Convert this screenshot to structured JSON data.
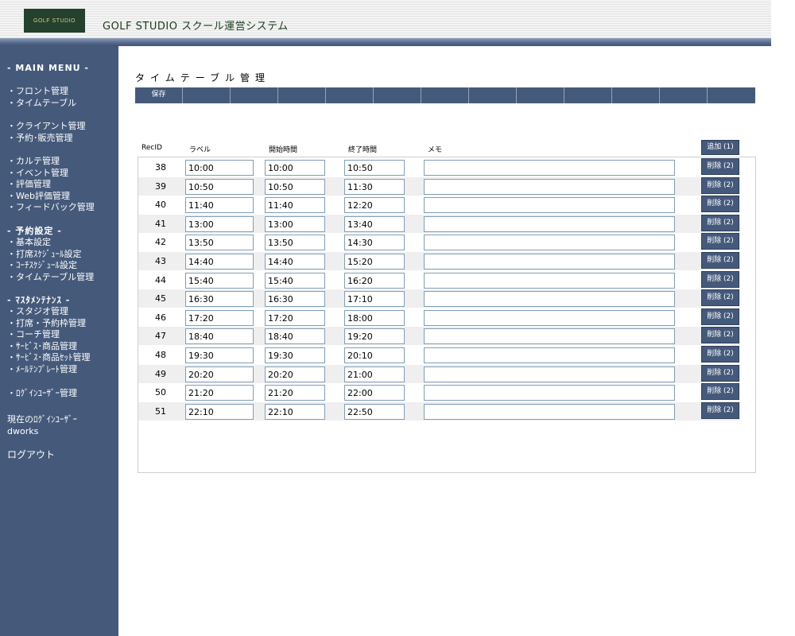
{
  "header": {
    "logo_text": "GOLF STUDIO",
    "app_title": "GOLF STUDIO スクール運営システム"
  },
  "sidebar": {
    "main_menu": "- MAIN MENU -",
    "group1": [
      "・フロント管理",
      "・タイムテーブル"
    ],
    "group2": [
      "・クライアント管理",
      "・予約･販売管理"
    ],
    "group3": [
      "・カルテ管理",
      "・イベント管理",
      "・評価管理",
      "・Web評価管理",
      "・フィードバック管理"
    ],
    "reserve_head": "- 予約設定 -",
    "reserve_items": [
      "・基本設定",
      "・打席ｽｹｼﾞｭｰﾙ設定",
      "・ｺｰﾁｽｹｼﾞｭｰﾙ設定",
      "・タイムテーブル管理"
    ],
    "master_head": "- ﾏｽﾀﾒﾝﾃﾅﾝｽ -",
    "master_items": [
      "・スタジオ管理",
      "・打席・予約枠管理",
      "・コーチ管理",
      "・ｻｰﾋﾞｽ･商品管理",
      "・ｻｰﾋﾞｽ･商品ｾｯﾄ管理",
      "・ﾒｰﾙﾃﾝﾌﾟﾚｰﾄ管理"
    ],
    "login_user_mgmt": "・ﾛｸﾞｲﾝﾕｰｻﾞｰ管理",
    "current_user_label": "現在のﾛｸﾞｲﾝﾕｰｻﾞｰ",
    "current_user": "dworks",
    "logout": "ログアウト"
  },
  "main": {
    "page_title": "タイムテーブル管理",
    "save_label": "保存",
    "columns": {
      "recid": "RecID",
      "label": "ラベル",
      "start": "開始時間",
      "end": "終了時間",
      "memo": "メモ"
    },
    "add_label": "追加 (1)",
    "delete_label": "削除 (2)",
    "rows": [
      {
        "id": "38",
        "label": "10:00",
        "start": "10:00",
        "end": "10:50",
        "memo": ""
      },
      {
        "id": "39",
        "label": "10:50",
        "start": "10:50",
        "end": "11:30",
        "memo": ""
      },
      {
        "id": "40",
        "label": "11:40",
        "start": "11:40",
        "end": "12:20",
        "memo": ""
      },
      {
        "id": "41",
        "label": "13:00",
        "start": "13:00",
        "end": "13:40",
        "memo": ""
      },
      {
        "id": "42",
        "label": "13:50",
        "start": "13:50",
        "end": "14:30",
        "memo": ""
      },
      {
        "id": "43",
        "label": "14:40",
        "start": "14:40",
        "end": "15:20",
        "memo": ""
      },
      {
        "id": "44",
        "label": "15:40",
        "start": "15:40",
        "end": "16:20",
        "memo": ""
      },
      {
        "id": "45",
        "label": "16:30",
        "start": "16:30",
        "end": "17:10",
        "memo": ""
      },
      {
        "id": "46",
        "label": "17:20",
        "start": "17:20",
        "end": "18:00",
        "memo": ""
      },
      {
        "id": "47",
        "label": "18:40",
        "start": "18:40",
        "end": "19:20",
        "memo": ""
      },
      {
        "id": "48",
        "label": "19:30",
        "start": "19:30",
        "end": "20:10",
        "memo": ""
      },
      {
        "id": "49",
        "label": "20:20",
        "start": "20:20",
        "end": "21:00",
        "memo": ""
      },
      {
        "id": "50",
        "label": "21:20",
        "start": "21:20",
        "end": "22:00",
        "memo": ""
      },
      {
        "id": "51",
        "label": "22:10",
        "start": "22:10",
        "end": "22:50",
        "memo": ""
      }
    ]
  }
}
